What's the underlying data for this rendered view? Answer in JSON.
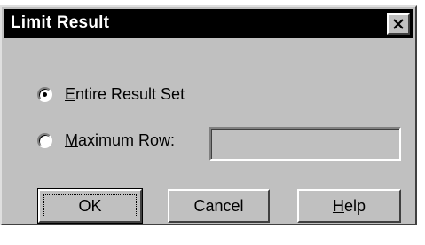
{
  "window": {
    "title": "Limit Result",
    "close_label": "Close"
  },
  "options": {
    "entire": {
      "mnemonic": "E",
      "rest": "ntire Result Set",
      "selected": true
    },
    "maximum": {
      "mnemonic": "M",
      "rest": "aximum Row:",
      "selected": false
    }
  },
  "max_row_field": {
    "value": ""
  },
  "buttons": {
    "ok": "OK",
    "cancel": "Cancel",
    "help_mnemonic": "H",
    "help_rest": "elp"
  }
}
